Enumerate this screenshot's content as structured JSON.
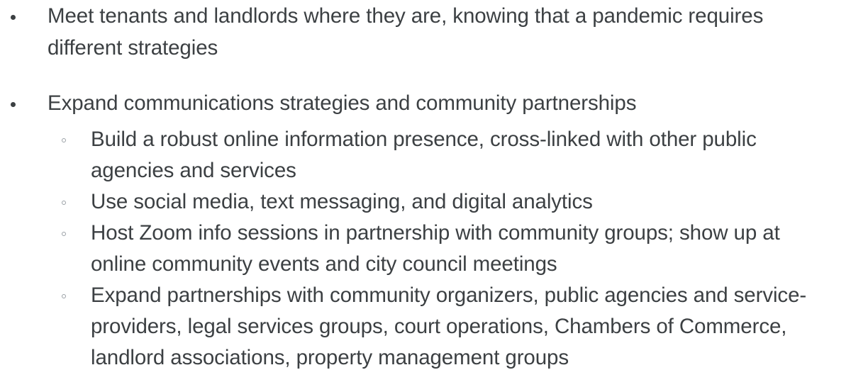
{
  "slide": {
    "background_color": "#ffffff",
    "text_color": "#3c4043",
    "marker_hollow_color": "#9aa0a6",
    "bullets": [
      {
        "level": 1,
        "marker": "filled-dot",
        "text": "Meet tenants and landlords where they are, knowing that a pandemic requires different strategies"
      },
      {
        "level": 1,
        "marker": "filled-dot",
        "text": "Expand communications strategies and community partnerships",
        "children": [
          {
            "level": 2,
            "marker": "hollow-circle",
            "text": "Build a robust online information presence, cross-linked with other public agencies and services"
          },
          {
            "level": 2,
            "marker": "hollow-circle",
            "text": "Use social media, text messaging, and digital analytics"
          },
          {
            "level": 2,
            "marker": "hollow-circle",
            "text": "Host Zoom info sessions in partnership with community groups; show up at online community events and city council meetings"
          },
          {
            "level": 2,
            "marker": "hollow-circle",
            "text": "Expand partnerships with community organizers, public agencies and service-providers, legal services groups, court operations, Chambers of Commerce, landlord associations, property management groups"
          }
        ]
      }
    ]
  }
}
